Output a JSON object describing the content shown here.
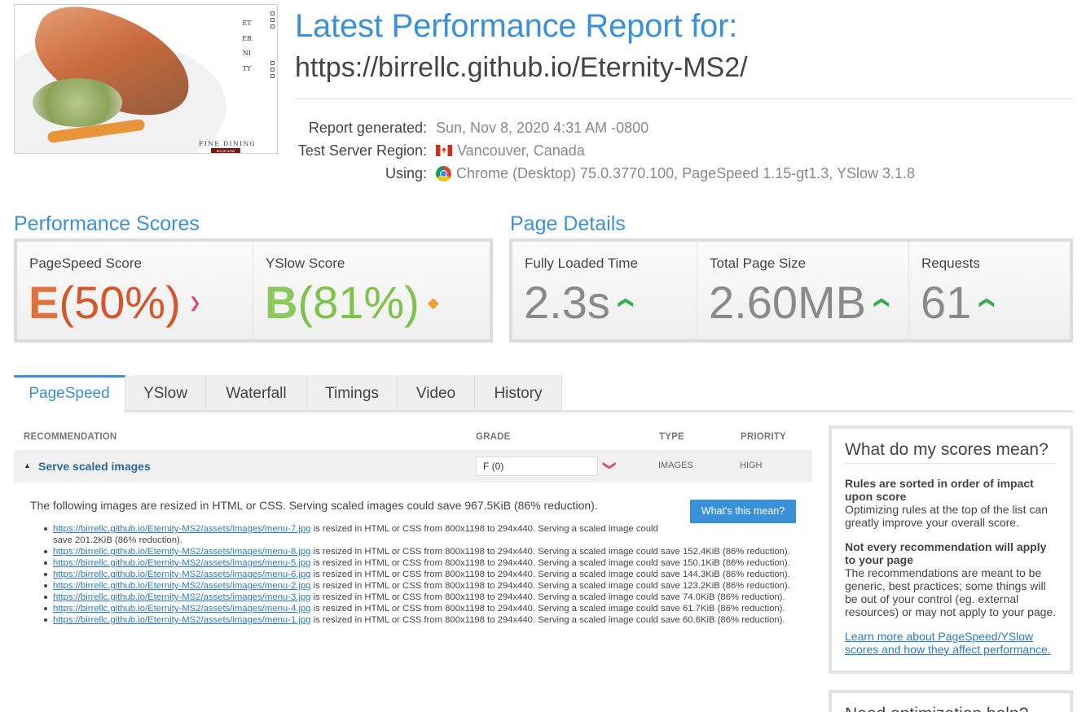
{
  "thumbnail": {
    "vertical_word": "ETERNITY",
    "tagline": "FINE DINING",
    "button": "BOOK NOW"
  },
  "header": {
    "title": "Latest Performance Report for:",
    "url": "https://birrellc.github.io/Eternity-MS2/",
    "report_generated_label": "Report generated:",
    "report_generated_value": "Sun, Nov 8, 2020 4:31 AM -0800",
    "region_label": "Test Server Region:",
    "region_value": "Vancouver, Canada",
    "using_label": "Using:",
    "using_value": "Chrome (Desktop) 75.0.3770.100, PageSpeed 1.15-gt1.3, YSlow 3.1.8"
  },
  "performance": {
    "title": "Performance Scores",
    "pagespeed_label": "PageSpeed Score",
    "pagespeed_grade": "E",
    "pagespeed_pct": "(50%)",
    "yslow_label": "YSlow Score",
    "yslow_grade": "B",
    "yslow_pct": "(81%)"
  },
  "page_details": {
    "title": "Page Details",
    "load_label": "Fully Loaded Time",
    "load_value": "2.3s",
    "size_label": "Total Page Size",
    "size_value": "2.60MB",
    "requests_label": "Requests",
    "requests_value": "61"
  },
  "tabs": [
    "PageSpeed",
    "YSlow",
    "Waterfall",
    "Timings",
    "Video",
    "History"
  ],
  "table": {
    "col_recommendation": "RECOMMENDATION",
    "col_grade": "GRADE",
    "col_type": "TYPE",
    "col_priority": "PRIORITY",
    "row": {
      "name": "Serve scaled images",
      "grade": "F (0)",
      "type": "IMAGES",
      "priority": "HIGH"
    },
    "summary": "The following images are resized in HTML or CSS. Serving scaled images could save 967.5KiB (86% reduction).",
    "button": "What's this mean?",
    "items": [
      {
        "url": "https://birrellc.github.io/Eternity-MS2/assets/images/menu-7.jpg",
        "text": " is resized in HTML or CSS from 800x1198 to 294x440. Serving a scaled image could save 201.2KiB (86% reduction)."
      },
      {
        "url": "https://birrellc.github.io/Eternity-MS2/assets/images/menu-8.jpg",
        "text": " is resized in HTML or CSS from 800x1198 to 294x440. Serving a scaled image could save 152.4KiB (86% reduction)."
      },
      {
        "url": "https://birrellc.github.io/Eternity-MS2/assets/images/menu-5.jpg",
        "text": " is resized in HTML or CSS from 800x1198 to 294x440. Serving a scaled image could save 150.1KiB (86% reduction)."
      },
      {
        "url": "https://birrellc.github.io/Eternity-MS2/assets/images/menu-6.jpg",
        "text": " is resized in HTML or CSS from 800x1198 to 294x440. Serving a scaled image could save 144.3KiB (86% reduction)."
      },
      {
        "url": "https://birrellc.github.io/Eternity-MS2/assets/images/menu-2.jpg",
        "text": " is resized in HTML or CSS from 800x1198 to 294x440. Serving a scaled image could save 123.2KiB (86% reduction)."
      },
      {
        "url": "https://birrellc.github.io/Eternity-MS2/assets/images/menu-3.jpg",
        "text": " is resized in HTML or CSS from 800x1198 to 294x440. Serving a scaled image could save 74.0KiB (86% reduction)."
      },
      {
        "url": "https://birrellc.github.io/Eternity-MS2/assets/images/menu-4.jpg",
        "text": " is resized in HTML or CSS from 800x1198 to 294x440. Serving a scaled image could save 61.7KiB (86% reduction)."
      },
      {
        "url": "https://birrellc.github.io/Eternity-MS2/assets/images/menu-1.jpg",
        "text": " is resized in HTML or CSS from 800x1198 to 294x440. Serving a scaled image could save 60.6KiB (86% reduction)."
      }
    ]
  },
  "side": {
    "title": "What do my scores mean?",
    "h1": "Rules are sorted in order of impact upon score",
    "p1": "Optimizing rules at the top of the list can greatly improve your overall score.",
    "h2": "Not every recommendation will apply to your page",
    "p2": "The recommendations are meant to be generic, best practices; some things will be out of your control (eg. external resources) or may not apply to your page.",
    "link": "Learn more about PageSpeed/YSlow scores and how they affect performance.",
    "title2": "Need optimization help?"
  },
  "colors": {
    "accent": "#3a90d9",
    "grade_e": "#d4562a",
    "grade_b": "#7dc24b",
    "trend_up": "#2eae4f",
    "trend_down": "#e0457b"
  },
  "icons": {
    "region": "canada-flag-icon",
    "browser": "chrome-icon",
    "pagespeed_trend": "chevron-down-icon",
    "yslow_trend": "diamond-icon",
    "detail_trend": "chevron-up-icon",
    "expand": "triangle-up-icon",
    "grade_trend": "chevron-down-icon"
  }
}
